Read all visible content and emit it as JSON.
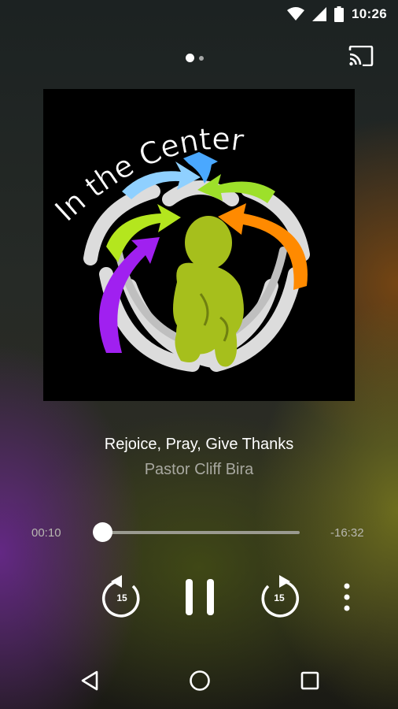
{
  "status_bar": {
    "time": "10:26",
    "icons": [
      "wifi-icon",
      "cell-signal-icon",
      "battery-icon"
    ]
  },
  "header": {
    "page_indicator": {
      "count": 2,
      "active": 0
    },
    "cast_icon": "cast-icon"
  },
  "artwork": {
    "logo_text": "In the Center"
  },
  "track": {
    "title": "Rejoice, Pray, Give Thanks",
    "artist": "Pastor Cliff Bira"
  },
  "playback": {
    "elapsed": "00:10",
    "remaining": "-16:32",
    "progress_fraction": 0.01
  },
  "controls": {
    "rewind_seconds": "15",
    "forward_seconds": "15",
    "play_state": "pause-icon",
    "more_icon": "more-vert-icon"
  },
  "nav": {
    "icons": [
      "back-icon",
      "home-icon",
      "recents-icon"
    ]
  },
  "colors": {
    "accent": "#ffffff",
    "artist_text": "#a8a8a0",
    "time_text": "#b8b8b0"
  }
}
